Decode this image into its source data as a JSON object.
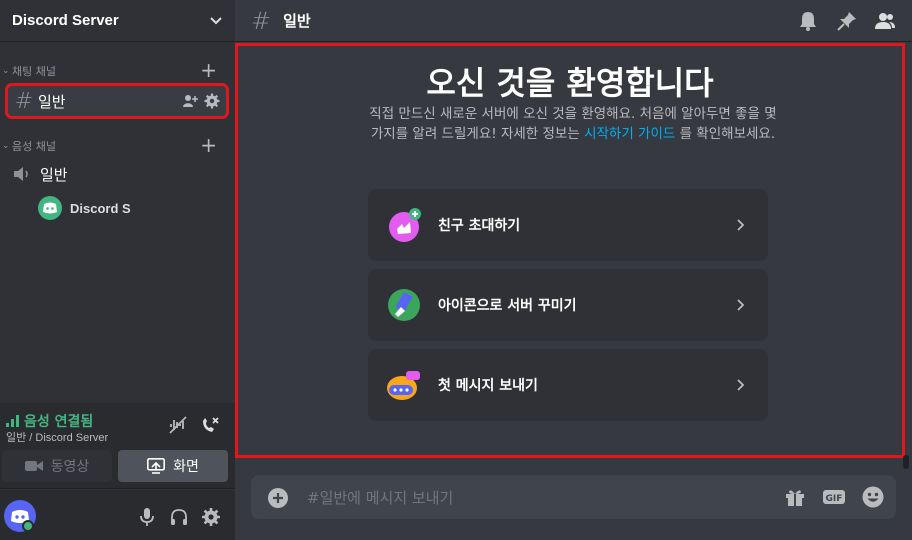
{
  "server": {
    "name": "Discord Server"
  },
  "categories": {
    "text": {
      "label": "채팅 채널"
    },
    "voice": {
      "label": "음성 채널"
    }
  },
  "channels": {
    "text": [
      {
        "name": "일반",
        "active": true
      }
    ],
    "voice": [
      {
        "name": "일반",
        "users": [
          "Discord S"
        ]
      }
    ]
  },
  "voice_panel": {
    "status": "음성 연결됨",
    "location": "일반 / Discord Server",
    "video_label": "동영상",
    "screen_label": "화면"
  },
  "topbar": {
    "channel_name": "일반"
  },
  "welcome": {
    "title": "오신 것을 환영합니다",
    "desc_text": "직접 만드신 새로운 서버에 오신 것을 환영해요. 처음에 알아두면 좋을 몇 가지를 알려    드릴게요! 자세한 정보는",
    "desc_link": "시작하기 가이드",
    "desc_suffix": "를 확인해보세요.",
    "cards": [
      {
        "label": "친구 초대하기",
        "icon": "invite-friends-icon"
      },
      {
        "label": "아이콘으로 서버 꾸미기",
        "icon": "personalize-server-icon"
      },
      {
        "label": "첫 메시지 보내기",
        "icon": "send-message-icon"
      }
    ]
  },
  "composer": {
    "placeholder": "#일반에 메시지 보내기"
  },
  "colors": {
    "accent": "#5865f2",
    "online": "#43b581",
    "link": "#00aff4",
    "highlight": "#e0181d"
  }
}
